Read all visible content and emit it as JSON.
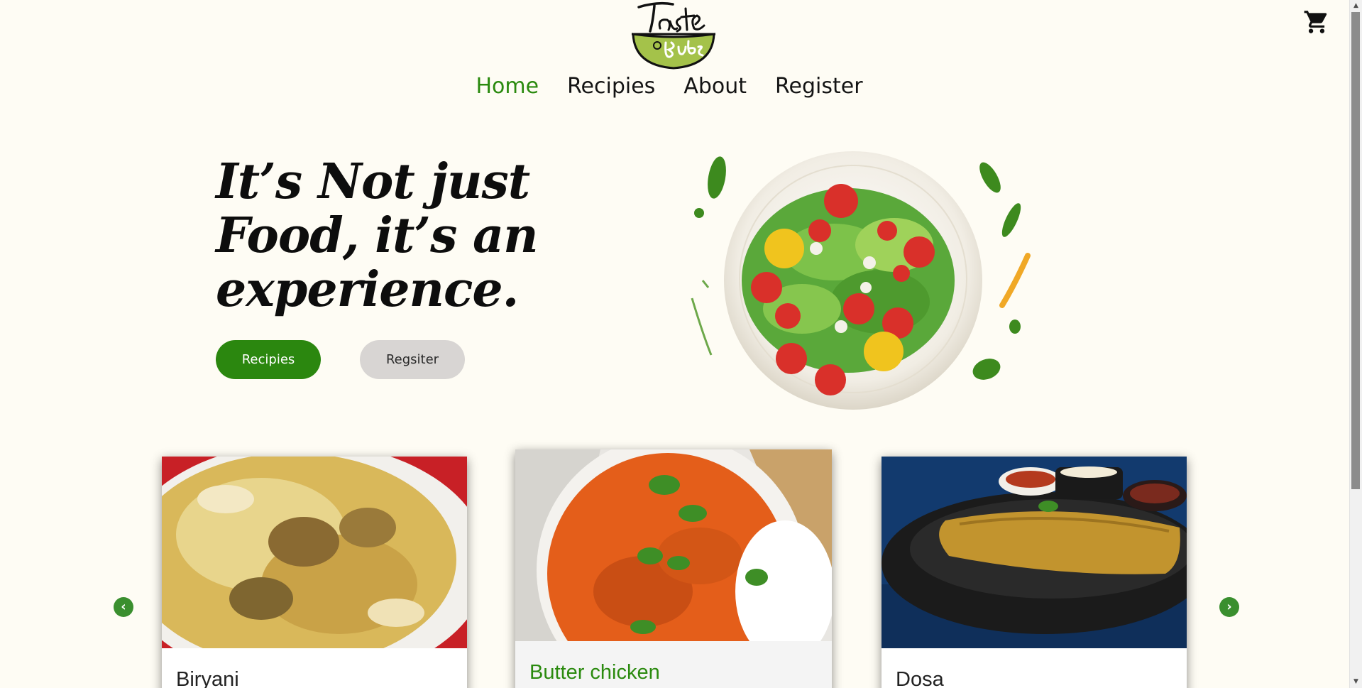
{
  "nav": {
    "items": [
      {
        "label": "Home",
        "active": true
      },
      {
        "label": "Recipies",
        "active": false
      },
      {
        "label": "About",
        "active": false
      },
      {
        "label": "Register",
        "active": false
      }
    ]
  },
  "hero": {
    "line1": "It’s Not just",
    "line2": "Food, it’s an",
    "line3": "experience.",
    "primary_button": "Recipies",
    "secondary_button": "Regsiter"
  },
  "carousel": {
    "cards": [
      {
        "title": "Biryani"
      },
      {
        "title": "Butter chicken"
      },
      {
        "title": "Dosa"
      }
    ]
  },
  "colors": {
    "accent": "#2b870f",
    "background": "#fefcf4",
    "secondary_button": "#d8d5d3"
  },
  "icons": {
    "cart": "shopping-cart-icon",
    "prev": "chevron-left-circle-icon",
    "next": "chevron-right-circle-icon"
  }
}
